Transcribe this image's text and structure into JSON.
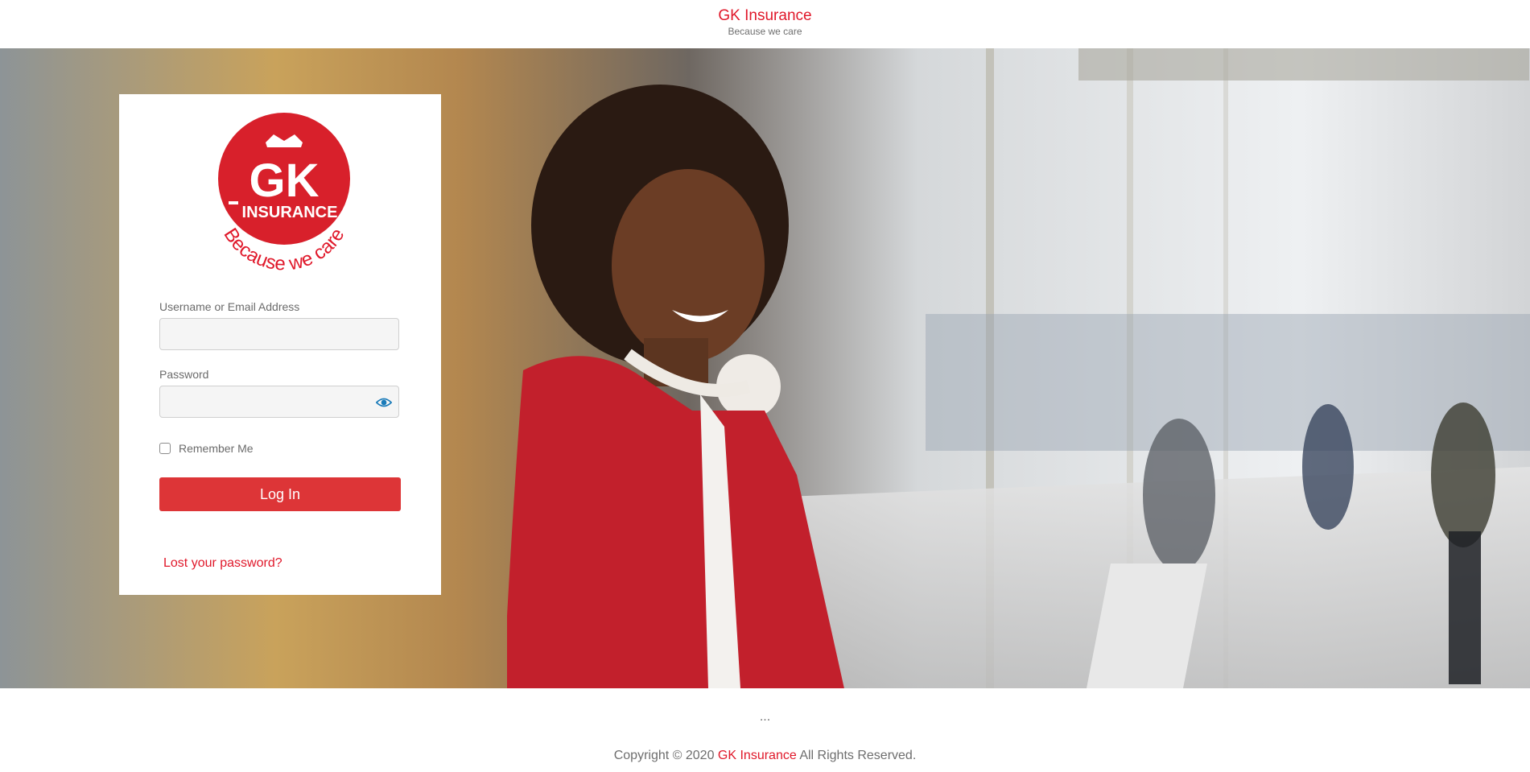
{
  "header": {
    "title": "GK Insurance",
    "tagline": "Because we care"
  },
  "logo": {
    "line1": "GK",
    "line2": "INSURANCE",
    "slogan": "Because we care"
  },
  "login": {
    "username_label": "Username or Email Address",
    "username_value": "",
    "password_label": "Password",
    "password_value": "",
    "remember_label": "Remember Me",
    "remember_checked": false,
    "submit_label": "Log In",
    "lost_password_label": "Lost your password?"
  },
  "footer": {
    "dots": "...",
    "copyright_prefix": "Copyright © 2020 ",
    "brand": "GK Insurance",
    "copyright_suffix": " All Rights Reserved."
  },
  "icons": {
    "password_toggle": "eye-icon",
    "checkbox": "checkbox-icon"
  },
  "colors": {
    "brand_red": "#e0182a",
    "button_red": "#dd3537",
    "eye_blue": "#1a7bb9"
  }
}
